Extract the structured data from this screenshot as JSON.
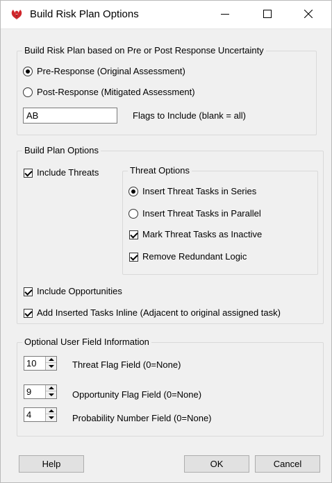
{
  "window": {
    "title": "Build Risk Plan Options"
  },
  "uncertainty": {
    "group_title": "Build Risk Plan based on Pre or Post Response Uncertainty",
    "options": [
      {
        "label": "Pre-Response (Original Assessment)",
        "selected": true
      },
      {
        "label": "Post-Response (Mitigated Assessment)",
        "selected": false
      }
    ],
    "flags_value": "AB",
    "flags_label": "Flags to Include (blank = all)"
  },
  "plan": {
    "group_title": "Build Plan Options",
    "include_threats": {
      "label": "Include Threats",
      "checked": true
    },
    "threat_options": {
      "group_title": "Threat Options",
      "insert_series": {
        "label": "Insert Threat Tasks in Series",
        "selected": true
      },
      "insert_parallel": {
        "label": "Insert Threat Tasks in Parallel",
        "selected": false
      },
      "mark_inactive": {
        "label": "Mark Threat Tasks as Inactive",
        "checked": true
      },
      "remove_redundant": {
        "label": "Remove Redundant Logic",
        "checked": true
      }
    },
    "include_opportunities": {
      "label": "Include Opportunities",
      "checked": true
    },
    "add_inline": {
      "label": "Add Inserted Tasks Inline (Adjacent to original assigned task)",
      "checked": true
    }
  },
  "user_fields": {
    "group_title": "Optional User Field Information",
    "threat_flag": {
      "value": "10",
      "label": "Threat Flag Field (0=None)"
    },
    "opportunity_flag": {
      "value": "9",
      "label": "Opportunity Flag Field (0=None)"
    },
    "probability": {
      "value": "4",
      "label": "Probability Number Field (0=None)"
    }
  },
  "buttons": {
    "help": "Help",
    "ok": "OK",
    "cancel": "Cancel"
  },
  "colors": {
    "window_bg": "#f0f0f0",
    "icon_red": "#d0262b"
  }
}
